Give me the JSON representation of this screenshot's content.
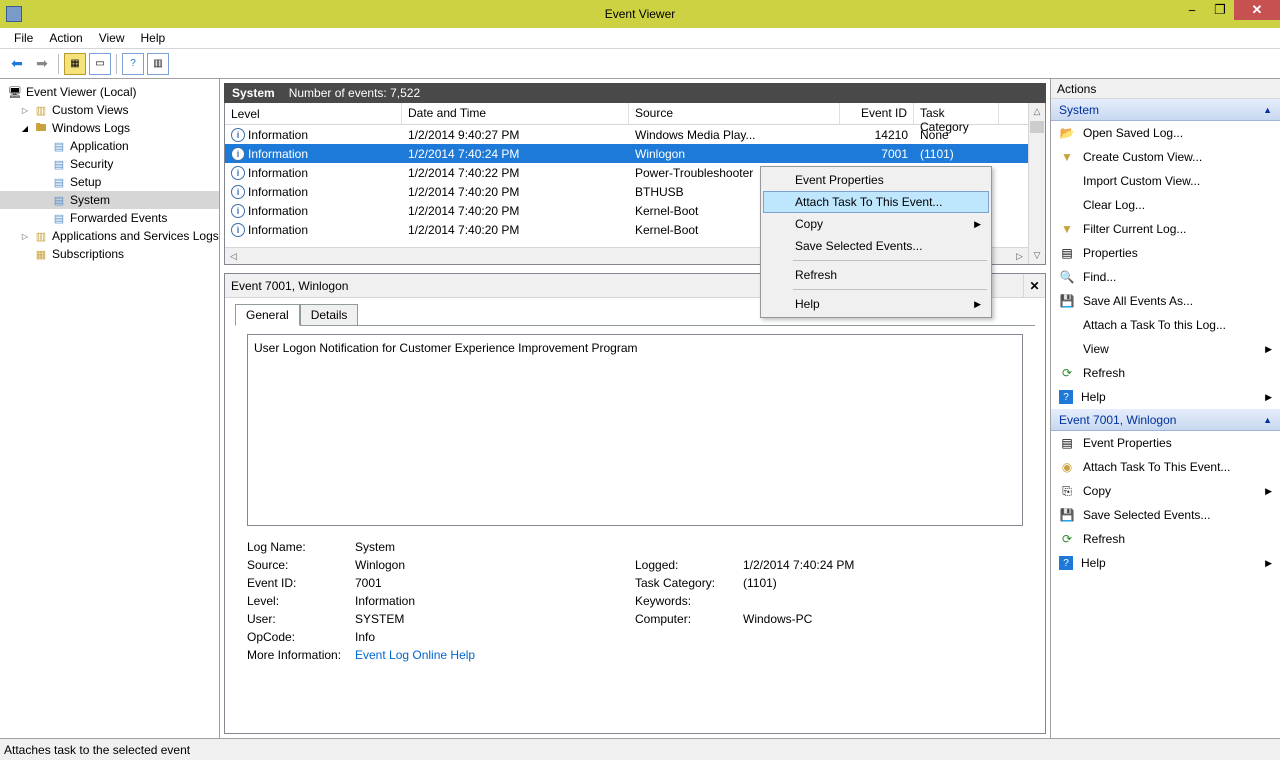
{
  "window": {
    "title": "Event Viewer"
  },
  "menubar": {
    "file": "File",
    "action": "Action",
    "view": "View",
    "help": "Help"
  },
  "tree": {
    "root": "Event Viewer (Local)",
    "customViews": "Custom Views",
    "windowsLogs": "Windows Logs",
    "application": "Application",
    "security": "Security",
    "setup": "Setup",
    "system": "System",
    "forwarded": "Forwarded Events",
    "appsvc": "Applications and Services Logs",
    "subscriptions": "Subscriptions"
  },
  "centerHeader": {
    "name": "System",
    "count": "Number of events: 7,522"
  },
  "grid": {
    "head": {
      "level": "Level",
      "date": "Date and Time",
      "source": "Source",
      "eid": "Event ID",
      "cat": "Task Category"
    },
    "rows": [
      {
        "level": "Information",
        "date": "1/2/2014 9:40:27 PM",
        "source": "Windows Media Play...",
        "eid": "14210",
        "cat": "None"
      },
      {
        "level": "Information",
        "date": "1/2/2014 7:40:24 PM",
        "source": "Winlogon",
        "eid": "7001",
        "cat": "(1101)"
      },
      {
        "level": "Information",
        "date": "1/2/2014 7:40:22 PM",
        "source": "Power-Troubleshooter",
        "eid": "",
        "cat": ""
      },
      {
        "level": "Information",
        "date": "1/2/2014 7:40:20 PM",
        "source": "BTHUSB",
        "eid": "",
        "cat": ""
      },
      {
        "level": "Information",
        "date": "1/2/2014 7:40:20 PM",
        "source": "Kernel-Boot",
        "eid": "",
        "cat": ""
      },
      {
        "level": "Information",
        "date": "1/2/2014 7:40:20 PM",
        "source": "Kernel-Boot",
        "eid": "",
        "cat": ""
      }
    ]
  },
  "contextMenu": {
    "eventProperties": "Event Properties",
    "attachTask": "Attach Task To This Event...",
    "copy": "Copy",
    "saveSelected": "Save Selected Events...",
    "refresh": "Refresh",
    "help": "Help"
  },
  "detailsPane": {
    "title": "Event 7001, Winlogon",
    "tabs": {
      "general": "General",
      "details": "Details"
    },
    "description": "User Logon Notification for Customer Experience Improvement Program",
    "fields": {
      "logNameLabel": "Log Name:",
      "logName": "System",
      "sourceLabel": "Source:",
      "source": "Winlogon",
      "loggedLabel": "Logged:",
      "logged": "1/2/2014 7:40:24 PM",
      "eventIdLabel": "Event ID:",
      "eventId": "7001",
      "taskCategoryLabel": "Task Category:",
      "taskCategory": "(1101)",
      "levelLabel": "Level:",
      "level": "Information",
      "keywordsLabel": "Keywords:",
      "keywords": "",
      "userLabel": "User:",
      "user": "SYSTEM",
      "computerLabel": "Computer:",
      "computer": "Windows-PC",
      "opCodeLabel": "OpCode:",
      "opCode": "Info",
      "moreInfoLabel": "More Information:",
      "moreInfo": "Event Log Online Help"
    }
  },
  "actions": {
    "title": "Actions",
    "systemHeader": "System",
    "openSaved": "Open Saved Log...",
    "createCustom": "Create Custom View...",
    "importCustom": "Import Custom View...",
    "clearLog": "Clear Log...",
    "filterCurrent": "Filter Current Log...",
    "properties": "Properties",
    "find": "Find...",
    "saveAll": "Save All Events As...",
    "attachLog": "Attach a Task To this Log...",
    "view": "View",
    "refresh": "Refresh",
    "help": "Help",
    "eventHeader": "Event 7001, Winlogon",
    "eventProperties": "Event Properties",
    "attachTaskEvent": "Attach Task To This Event...",
    "copy": "Copy",
    "saveSelected": "Save Selected Events...",
    "refresh2": "Refresh",
    "help2": "Help"
  },
  "status": {
    "text": "Attaches task to the selected event"
  }
}
